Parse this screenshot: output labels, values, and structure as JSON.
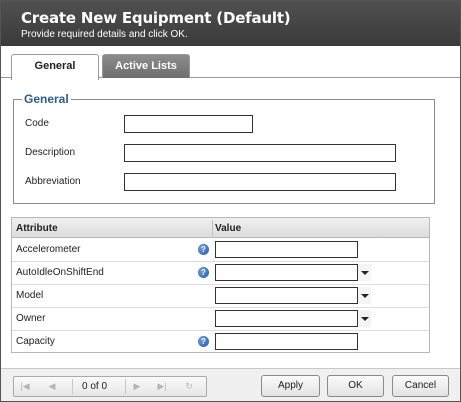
{
  "header": {
    "title": "Create New Equipment (Default)",
    "subtitle": "Provide required details and click OK."
  },
  "tabs": [
    {
      "label": "General",
      "active": true
    },
    {
      "label": "Active Lists",
      "active": false
    }
  ],
  "general": {
    "legend": "General",
    "fields": [
      {
        "label": "Code",
        "value": ""
      },
      {
        "label": "Description",
        "value": ""
      },
      {
        "label": "Abbreviation",
        "value": ""
      }
    ]
  },
  "grid": {
    "headers": {
      "attribute": "Attribute",
      "value": "Value"
    },
    "rows": [
      {
        "attribute": "Accelerometer",
        "has_help": true,
        "type": "text",
        "value": ""
      },
      {
        "attribute": "AutoIdleOnShiftEnd",
        "has_help": true,
        "type": "select",
        "value": ""
      },
      {
        "attribute": "Model",
        "has_help": false,
        "type": "select",
        "value": ""
      },
      {
        "attribute": "Owner",
        "has_help": false,
        "type": "select",
        "value": ""
      },
      {
        "attribute": "Capacity",
        "has_help": true,
        "type": "text",
        "value": ""
      }
    ]
  },
  "pager": {
    "text": "0 of 0",
    "icons": [
      "first-page-icon",
      "prev-page-icon",
      "next-page-icon",
      "last-page-icon",
      "refresh-icon"
    ]
  },
  "buttons": {
    "apply": "Apply",
    "ok": "OK",
    "cancel": "Cancel"
  },
  "colors": {
    "header_bg": "#444444",
    "legend": "#2a5c9a",
    "help_icon": "#1d56b5"
  }
}
